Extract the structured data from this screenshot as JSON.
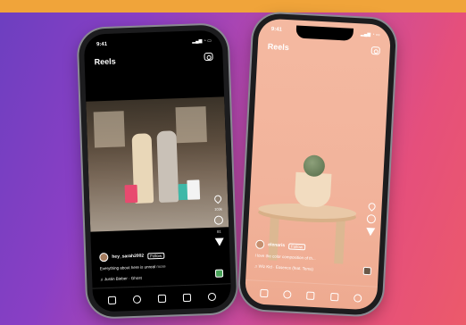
{
  "colors": {
    "banner": "#f0a43a",
    "gradient_start": "#6d3fc0",
    "gradient_end": "#ec5a6a"
  },
  "phone_left": {
    "time": "9:41",
    "header_title": "Reels",
    "camera_icon": "camera-icon",
    "counts": {
      "likes": "103k",
      "comments": "81"
    },
    "username": "hey_sarah2002",
    "follow_label": "Follow",
    "caption": "Everything about here is unreal",
    "caption_more": "more",
    "music": "Justin Bieber · Ghost",
    "nav": [
      "home-icon",
      "search-icon",
      "reels-icon",
      "shop-icon",
      "profile-icon"
    ]
  },
  "phone_right": {
    "time": "9:41",
    "header_title": "Reels",
    "camera_icon": "camera-icon",
    "username": "elenaris",
    "follow_label": "Follow",
    "caption": "I love the color composition of th...",
    "music": "Wiz Kid · Essence (feat. Tems)",
    "nav": [
      "home-icon",
      "search-icon",
      "reels-icon",
      "shop-icon",
      "profile-icon"
    ]
  }
}
